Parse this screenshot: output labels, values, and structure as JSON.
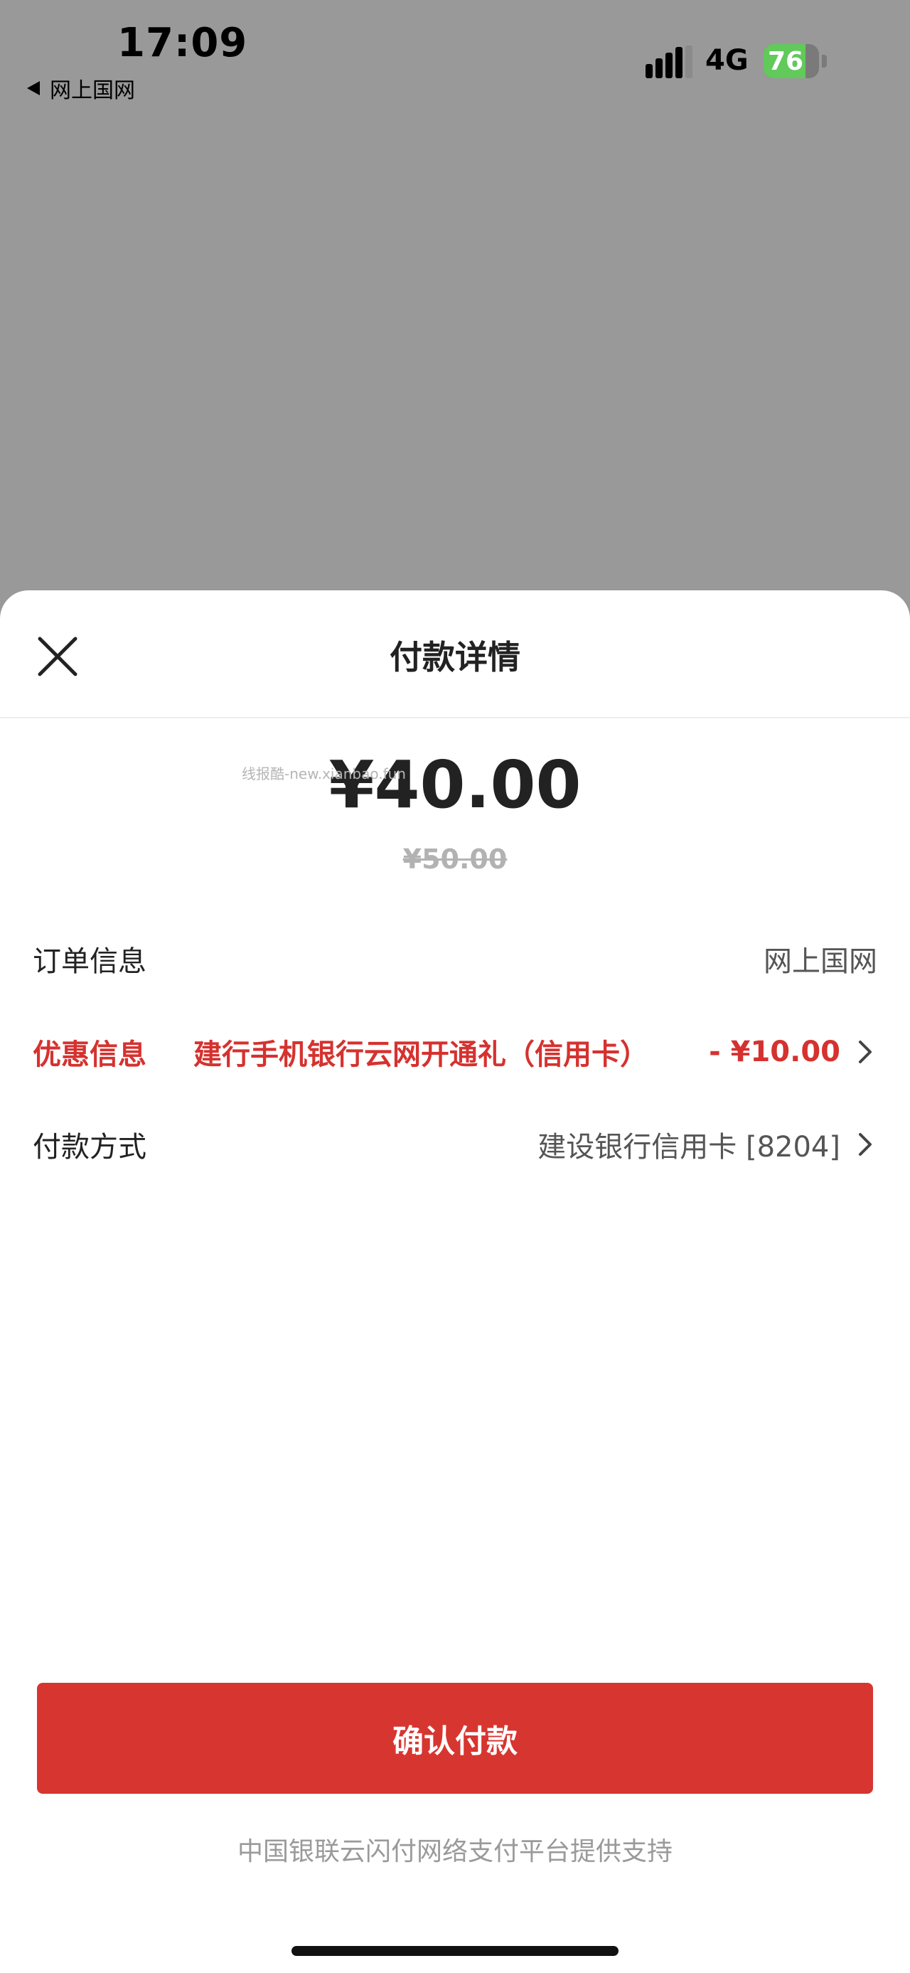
{
  "status_bar": {
    "time": "17:09",
    "back_app": "网上国网",
    "network": "4G",
    "battery_text": "76",
    "battery_level": 0.76
  },
  "sheet": {
    "title": "付款详情",
    "close_icon": "close-icon",
    "watermark": "线报酷-new.xianbao.fun",
    "amount": "¥40.00",
    "original_amount": "¥50.00"
  },
  "order_info": {
    "label": "订单信息",
    "value": "网上国网"
  },
  "discount_info": {
    "label": "优惠信息",
    "name": "建行手机银行云网开通礼（信用卡）",
    "amount": "- ¥10.00",
    "icon": "chevron-right-icon"
  },
  "payment_method": {
    "label": "付款方式",
    "value": "建设银行信用卡 [8204]",
    "icon": "chevron-right-icon"
  },
  "confirm_button": "确认付款",
  "footer_note": "中国银联云闪付网络支付平台提供支持",
  "colors": {
    "accent": "#d73530",
    "discount_text": "#d5322f",
    "overlay": "#999999",
    "battery_fill": "#62c95b"
  }
}
